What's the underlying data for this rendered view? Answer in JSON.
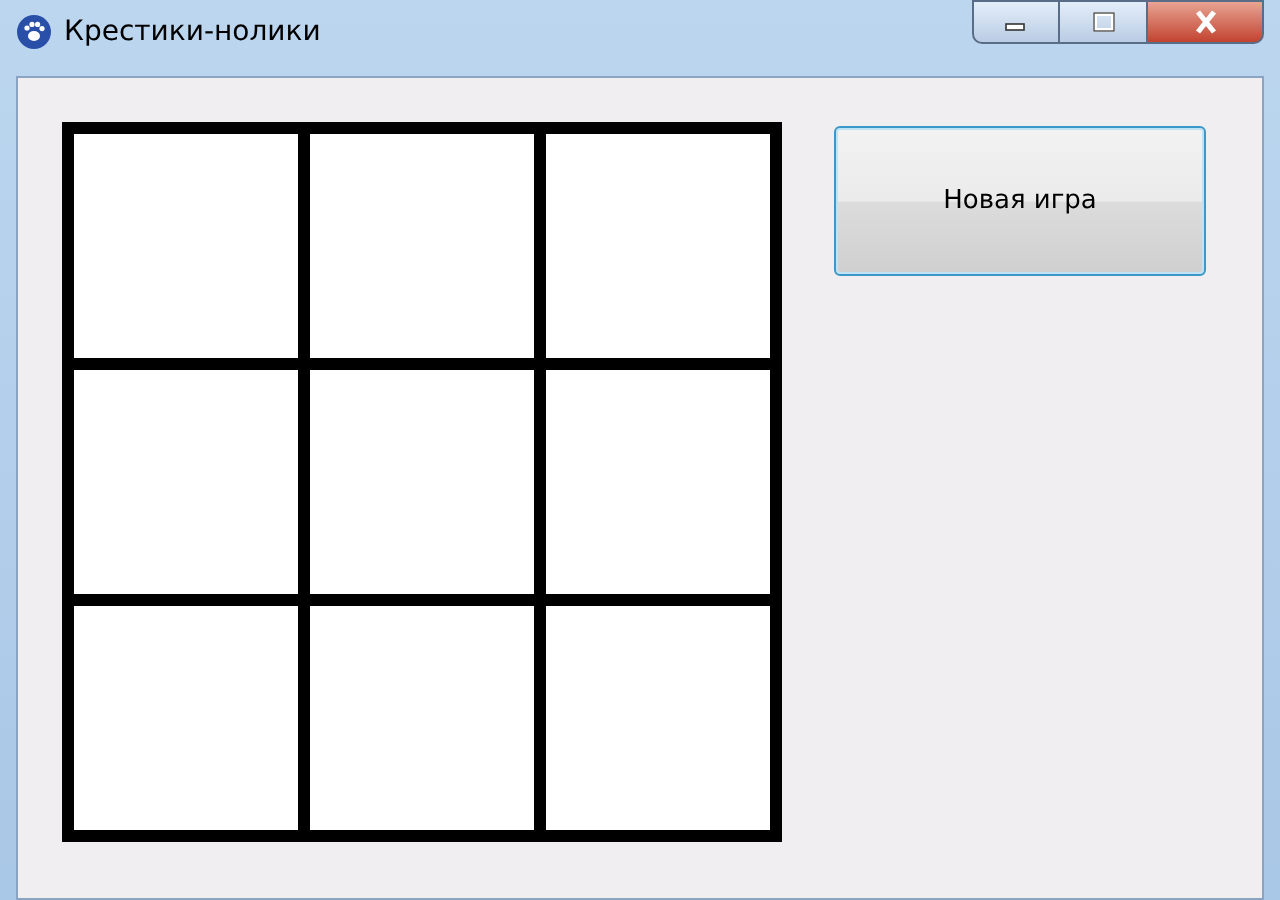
{
  "window": {
    "title": "Крестики-нолики"
  },
  "board": {
    "cells": [
      {
        "cross": false,
        "nought": false
      },
      {
        "cross": false,
        "nought": false
      },
      {
        "cross": false,
        "nought": false
      },
      {
        "cross": false,
        "nought": false
      },
      {
        "cross": false,
        "nought": false
      },
      {
        "cross": false,
        "nought": false
      },
      {
        "cross": false,
        "nought": false
      },
      {
        "cross": false,
        "nought": false
      },
      {
        "cross": false,
        "nought": false
      }
    ]
  },
  "buttons": [
    "Новая игра"
  ]
}
